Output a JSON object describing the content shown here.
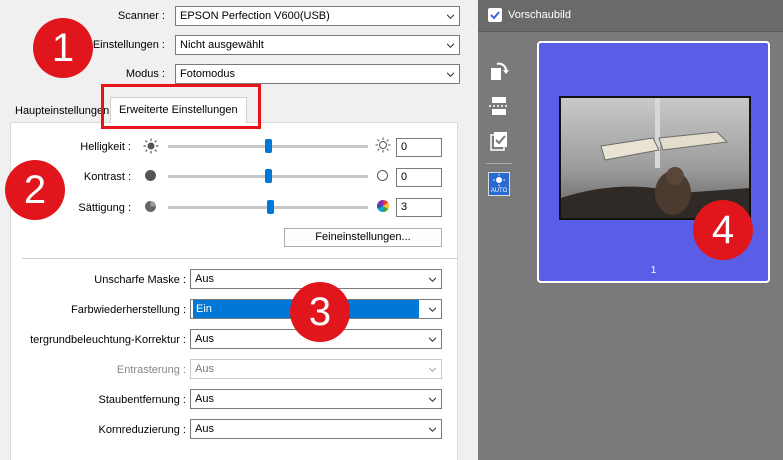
{
  "scanner_settings": {
    "scanner_label": "Scanner :",
    "scanner_value": "EPSON Perfection V600(USB)",
    "preset_label": "n-Einstellungen :",
    "preset_value": "Nicht ausgewählt",
    "mode_label": "Modus :",
    "mode_value": "Fotomodus"
  },
  "tabs": {
    "main": "Haupteinstellungen",
    "advanced": "Erweiterte Einstellungen",
    "active": "advanced"
  },
  "adjustments": {
    "brightness": {
      "label": "Helligkeit :",
      "value": "0",
      "level": 0.5
    },
    "contrast": {
      "label": "Kontrast :",
      "value": "0",
      "level": 0.5
    },
    "saturation": {
      "label": "Sättigung :",
      "value": "3",
      "level": 0.51
    },
    "fine_tune_button": "Feineinstellungen..."
  },
  "image_options": {
    "unsharp_mask": {
      "label": "Unscharfe Maske :",
      "value": "Aus"
    },
    "color_restoration": {
      "label": "Farbwiederherstellung :",
      "value": "Ein"
    },
    "backlight_correction": {
      "label": "tergrundbeleuchtung-Korrektur :",
      "value": "Aus"
    },
    "descreening": {
      "label": "Entrasterung :",
      "value": "Aus",
      "disabled": true
    },
    "dust_removal": {
      "label": "Staubentfernung :",
      "value": "Aus"
    },
    "grain_reduction": {
      "label": "Kornreduzierung :",
      "value": "Aus"
    }
  },
  "preview": {
    "checkbox_label": "Vorschaubild",
    "checked": true,
    "thumbnail_number": "1",
    "auto_icon_text": "AUTO"
  },
  "annotations": {
    "badge_1": "1",
    "badge_2": "2",
    "badge_3": "3",
    "badge_4": "4"
  },
  "colors": {
    "accent": "#0078d7",
    "annotation_red": "#e0161c",
    "thumbnail_bg": "#5a5ee6",
    "preview_panel_bg": "#7a7a7a"
  }
}
